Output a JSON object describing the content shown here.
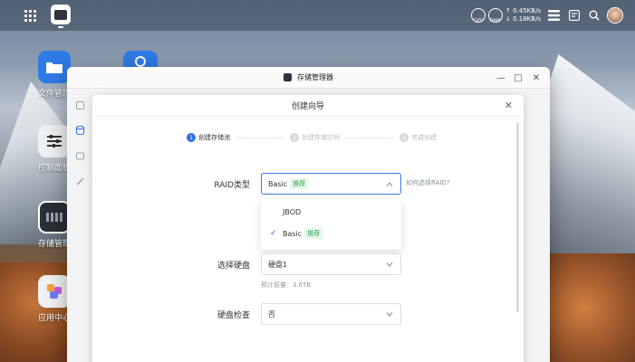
{
  "topbar": {
    "icons": {
      "grid": "app-grid-icon",
      "active_app": "storage-manager-icon",
      "gpu": "gpu-gauge-icon",
      "ram": "ram-gauge-icon",
      "tasks": "task-list-icon",
      "notify": "notification-icon",
      "search": "search-icon",
      "avatar": "user-avatar"
    },
    "gpu_label": "GPU",
    "ram_label": "RAM",
    "upload": "↑ 0.45KB/s",
    "download": "↓ 0.18KB/s"
  },
  "desktop": {
    "icons": [
      {
        "label": "文件管理",
        "icon": "folder-icon",
        "color": "#2f7be6"
      },
      {
        "label": "控制面板",
        "icon": "sliders-icon",
        "color": "#eef0f3"
      },
      {
        "label": "存储管理",
        "icon": "storage-icon",
        "color": "#2b2f36"
      },
      {
        "label": "应用中心",
        "icon": "app-center-icon",
        "color": "#f1f1f1"
      }
    ]
  },
  "window": {
    "title": "存储管理器",
    "controls": {
      "minimize": "—",
      "maximize": "□",
      "close": "✕"
    }
  },
  "wizard": {
    "title": "创建向导",
    "close": "✕",
    "steps": [
      {
        "num": "1",
        "label": "创建存储池",
        "active": true
      },
      {
        "num": "2",
        "label": "创建存储空间",
        "active": false
      },
      {
        "num": "3",
        "label": "完成创建",
        "active": false
      }
    ],
    "raid": {
      "label": "RAID类型",
      "value": "Basic",
      "tag": "推荐",
      "help": "如何选择RAID?",
      "options": [
        {
          "label": "JBOD",
          "tag": "",
          "selected": false
        },
        {
          "label": "Basic",
          "tag": "推荐",
          "selected": true
        }
      ]
    },
    "disk": {
      "label": "选择硬盘",
      "value": "硬盘1",
      "hint": "预计容量：3.6TB"
    },
    "check": {
      "label": "硬盘检查",
      "value": "否"
    }
  },
  "colors": {
    "accent": "#2f6fe4",
    "tag_green": "#34a853"
  }
}
